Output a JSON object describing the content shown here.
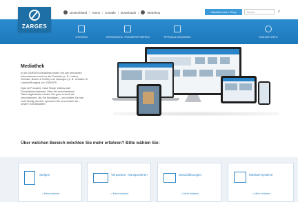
{
  "header": {
    "logo_text": "ZARGES",
    "utility_links": [
      "Deutschland",
      "Home",
      "Kontakt",
      "Downloads",
      "Webshop"
    ],
    "cta_label": "Händlersuche / Shop",
    "search_placeholder": "Suche",
    "search_icon": "magnifier-icon"
  },
  "nav": {
    "items": [
      {
        "label": "STEIGEN",
        "icon": "ladder-icon"
      },
      {
        "label": "VERPACKEN, TRANSPORTIEREN",
        "icon": "box-icon"
      },
      {
        "label": "SPEZIALLÖSUNGEN",
        "icon": "special-icon"
      },
      {
        "label": "ZARGES INFO",
        "icon": "info-icon"
      }
    ]
  },
  "mediathek": {
    "title": "Mediathek",
    "paragraphs": [
      "In der ZARGES Mediathek finden Sie alle relevanten Informationen rund um die Produkte (z. B. Leitern, Gerüste, Boxen & Koffer) und Lösungen (z. B. Verladen & Lastenlüftungen) von ZARGES.",
      "Egal ob Prospekt, Case Study, Videos oder Produktinformationen: Über die verschiedenen Filtermöglichkeiten finden Sie ganz schnell die Informationen, die Sie benötigen – und sollten Sie mal nicht fündig werden, sprechen Sie uns einfach an – unsere Kontaktdaten!"
    ]
  },
  "question": "Über welchen Bereich möchten Sie mehr erfahren? Bitte wählen Sie:",
  "cards": [
    {
      "label": "Steigen",
      "more": "> Mehr erfahren",
      "icon": "ladder-icon"
    },
    {
      "label": "Verpacken, Transportieren",
      "more": "> Mehr erfahren",
      "icon": "box-icon"
    },
    {
      "label": "Speziallösungen",
      "more": "> Mehr erfahren",
      "icon": "stairs-icon"
    },
    {
      "label": "Medical-Systeme",
      "more": "> Mehr erfahren",
      "icon": "medical-icon"
    }
  ],
  "colors": {
    "brand_blue": "#1d6fa6",
    "nav_blue": "#2b8cd0",
    "accent_link": "#2a85c8",
    "cards_bg": "#eef2f6"
  }
}
